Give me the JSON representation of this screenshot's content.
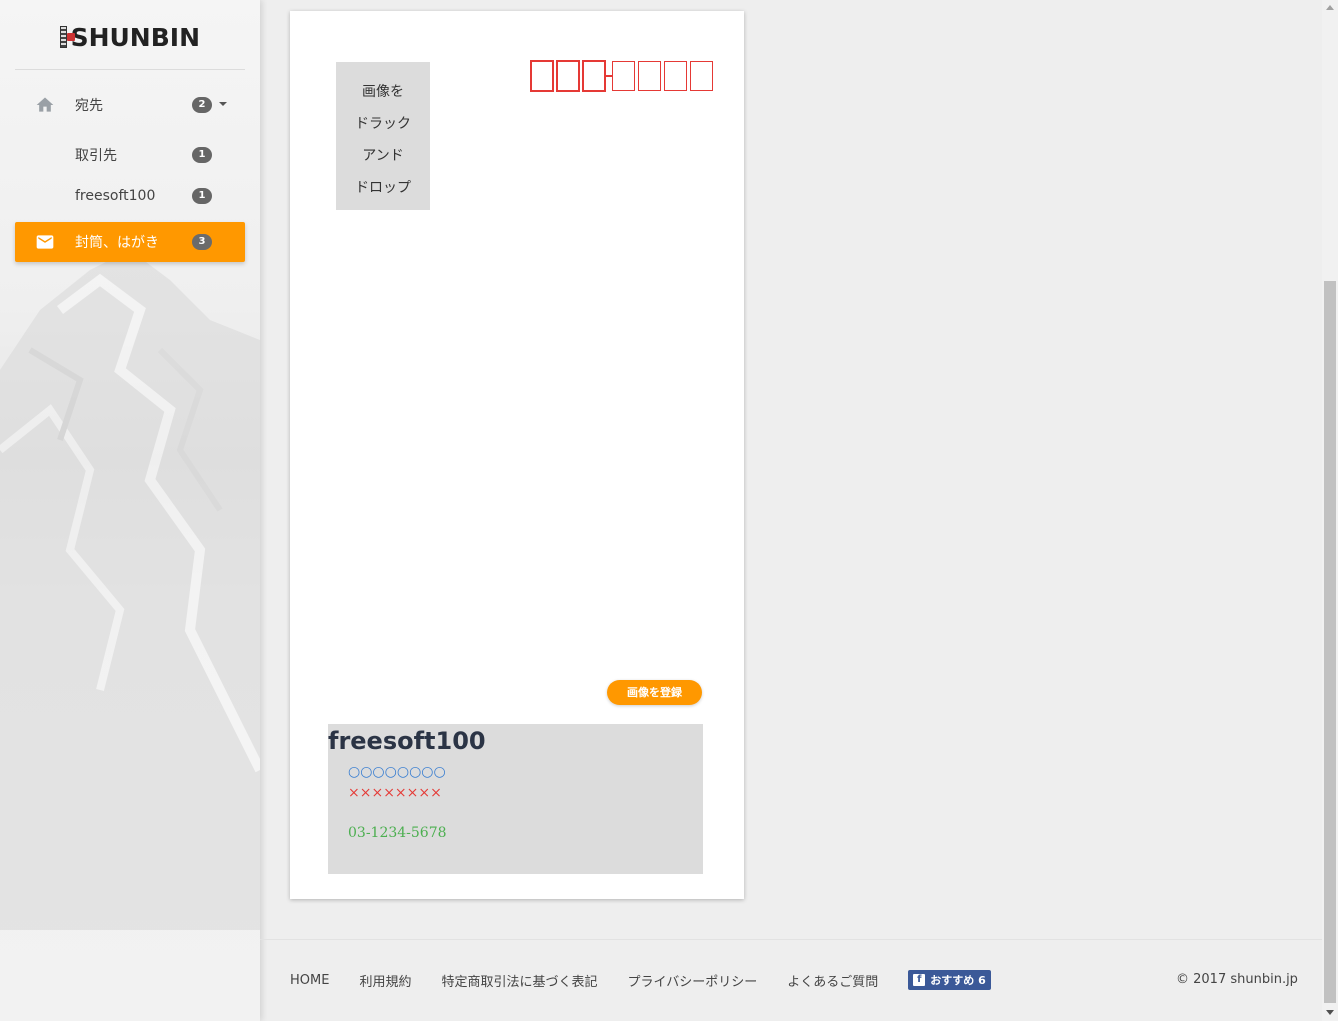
{
  "brand": {
    "logo_text": "SHUNBIN"
  },
  "sidebar": {
    "items": [
      {
        "label": "宛先",
        "badge": "2",
        "icon": "home-icon"
      },
      {
        "label": "取引先",
        "badge": "1"
      },
      {
        "label": "freesoft100",
        "badge": "1"
      },
      {
        "label": "封筒、はがき",
        "badge": "3",
        "icon": "mail-icon"
      }
    ]
  },
  "card": {
    "dropzone_lines": [
      "画像を",
      "ドラック",
      "アンド",
      "ドロップ"
    ],
    "register_button": "画像を登録",
    "sender": {
      "name": "freesoft100",
      "line1": "○○○○○○○○",
      "line2": "××××××××",
      "phone": "03-1234-5678"
    }
  },
  "footer": {
    "links": [
      "HOME",
      "利用規約",
      "特定商取引法に基づく表記",
      "プライバシーポリシー",
      "よくあるご質問"
    ],
    "facebook_label": "おすすめ 6",
    "copyright": "© 2017 shunbin.jp"
  },
  "colors": {
    "accent": "#ff9800",
    "postal_red": "#e53935",
    "phone_green": "#4caf50",
    "dot_blue": "#3b7fd1",
    "facebook": "#3b5998"
  }
}
